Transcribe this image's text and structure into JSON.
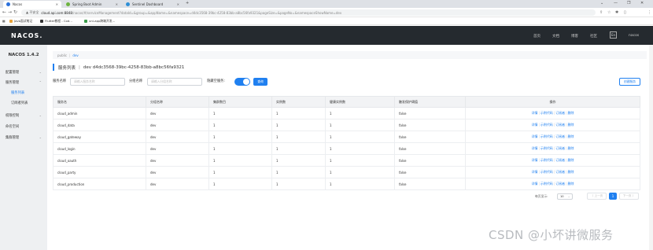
{
  "browser": {
    "tabs": [
      {
        "title": "Nacos",
        "color": "#2a6fdb"
      },
      {
        "title": "Spring Boot Admin",
        "color": "#6db33f"
      },
      {
        "title": "Sentinel Dashboard",
        "color": "#2f8fd6"
      }
    ],
    "new_tab": "+",
    "window_controls": [
      "⌄",
      "—",
      "❐",
      "✕"
    ],
    "nav": [
      "←",
      "→",
      "↻",
      "⌂"
    ],
    "not_secure": "▲ 不安全",
    "url_host": "cloud.api.com:8848",
    "url_rest": "/nacos/#/serviceManagement?dataId=&group=&appName=&namespace=d4dc3568-39bc-4258-83bb-a8bc56fa9321&pageSize=&pageNo=&namespaceShowName=dev",
    "profile_badge": "暂停",
    "bookmarks": [
      {
        "label": "Java面试笔记",
        "color": "#e8a33a"
      },
      {
        "label": "Flutter教程 - Cod...",
        "color": "#333333"
      },
      {
        "label": "uni-app跨端开发...",
        "color": "#3b9b4a"
      }
    ]
  },
  "header": {
    "logo": "NACOS.",
    "nav": [
      "首页",
      "文档",
      "博客",
      "社区"
    ],
    "lang": "En",
    "user": "nacos"
  },
  "sidebar": {
    "version": "NACOS 1.4.2",
    "items": [
      {
        "label": "配置管理",
        "chev": "⌄"
      },
      {
        "label": "服务管理",
        "chev": "⌃"
      },
      {
        "label": "服务列表"
      },
      {
        "label": "订阅者列表"
      },
      {
        "label": "权限控制",
        "chev": "⌄"
      },
      {
        "label": "命名空间"
      },
      {
        "label": "集群管理",
        "chev": "⌄"
      }
    ]
  },
  "breadcrumb": {
    "public": "public",
    "sep": "|",
    "dev": "dev"
  },
  "title": {
    "text": "服务列表",
    "sep": "|",
    "namespace": "dev  d4dc3568-39bc-4258-83bb-a8bc56fa9321"
  },
  "filters": {
    "service_label": "服务名称",
    "service_placeholder": "请输入服务名称",
    "group_label": "分组名称",
    "group_placeholder": "请输入分组名称",
    "hide_empty_label": "隐藏空服务:",
    "query": "查询",
    "create": "创建服务"
  },
  "table": {
    "headers": [
      "服务名",
      "分组名称",
      "集群数目",
      "实例数",
      "健康实例数",
      "触发保护阈值",
      "操作"
    ],
    "rows": [
      [
        "cloud_admin",
        "dev",
        "1",
        "1",
        "1",
        "false"
      ],
      [
        "cloud_data",
        "dev",
        "1",
        "1",
        "1",
        "false"
      ],
      [
        "cloud_gateway",
        "dev",
        "1",
        "1",
        "1",
        "false"
      ],
      [
        "cloud_login",
        "dev",
        "1",
        "1",
        "1",
        "false"
      ],
      [
        "cloud_oauth",
        "dev",
        "1",
        "1",
        "1",
        "false"
      ],
      [
        "cloud_party",
        "dev",
        "1",
        "1",
        "1",
        "false"
      ],
      [
        "cloud_production",
        "dev",
        "1",
        "1",
        "1",
        "false"
      ]
    ],
    "actions": [
      "详情",
      "示例代码",
      "订阅者",
      "删除"
    ],
    "action_sep": "|"
  },
  "pagination": {
    "per_page_label": "每页显示:",
    "per_page": "10",
    "prev": "〈 上一页",
    "current": "1",
    "next": "下一页 〉"
  },
  "watermark": "CSDN @小坏讲微服务"
}
